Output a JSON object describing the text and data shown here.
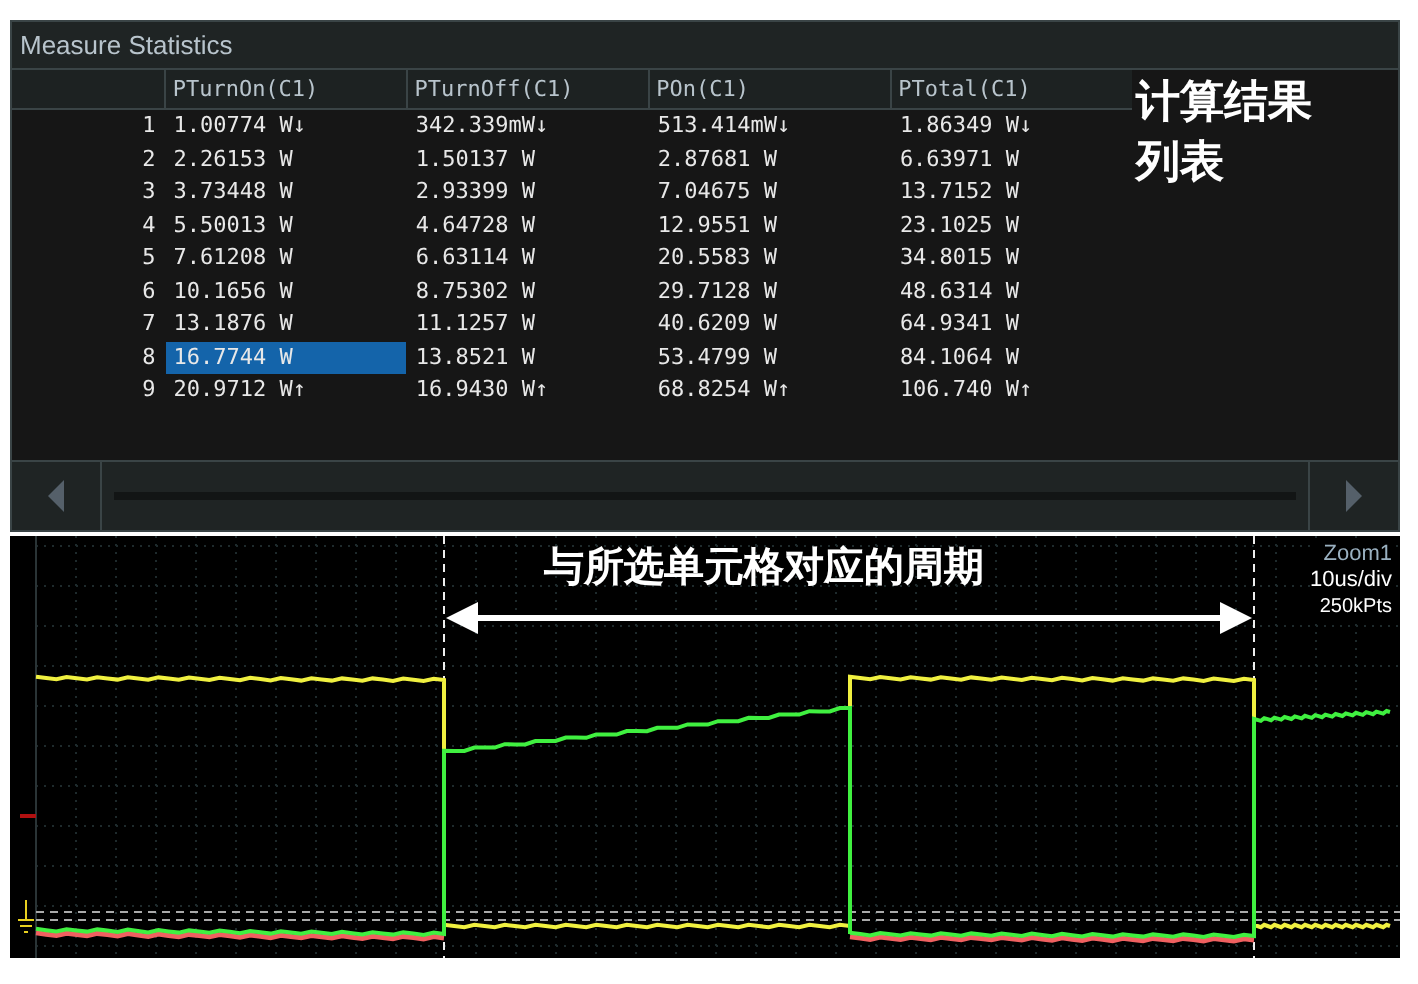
{
  "panel": {
    "title": "Measure Statistics"
  },
  "table": {
    "columns": [
      "PTurnOn(C1)",
      "PTurnOff(C1)",
      "POn(C1)",
      "PTotal(C1)"
    ],
    "rows": [
      {
        "index": "1",
        "cells": [
          {
            "text": "1.00774 W↓",
            "selected": false
          },
          {
            "text": "342.339mW↓",
            "selected": false
          },
          {
            "text": "513.414mW↓",
            "selected": false
          },
          {
            "text": "1.86349 W↓",
            "selected": false
          }
        ]
      },
      {
        "index": "2",
        "cells": [
          {
            "text": "2.26153 W",
            "selected": false
          },
          {
            "text": "1.50137 W",
            "selected": false
          },
          {
            "text": "2.87681 W",
            "selected": false
          },
          {
            "text": "6.63971 W",
            "selected": false
          }
        ]
      },
      {
        "index": "3",
        "cells": [
          {
            "text": "3.73448 W",
            "selected": false
          },
          {
            "text": "2.93399 W",
            "selected": false
          },
          {
            "text": "7.04675 W",
            "selected": false
          },
          {
            "text": "13.7152 W",
            "selected": false
          }
        ]
      },
      {
        "index": "4",
        "cells": [
          {
            "text": "5.50013 W",
            "selected": false
          },
          {
            "text": "4.64728 W",
            "selected": false
          },
          {
            "text": "12.9551 W",
            "selected": false
          },
          {
            "text": "23.1025 W",
            "selected": false
          }
        ]
      },
      {
        "index": "5",
        "cells": [
          {
            "text": "7.61208 W",
            "selected": false
          },
          {
            "text": "6.63114 W",
            "selected": false
          },
          {
            "text": "20.5583 W",
            "selected": false
          },
          {
            "text": "34.8015 W",
            "selected": false
          }
        ]
      },
      {
        "index": "6",
        "cells": [
          {
            "text": "10.1656 W",
            "selected": false
          },
          {
            "text": "8.75302 W",
            "selected": false
          },
          {
            "text": "29.7128 W",
            "selected": false
          },
          {
            "text": "48.6314 W",
            "selected": false
          }
        ]
      },
      {
        "index": "7",
        "cells": [
          {
            "text": "13.1876 W",
            "selected": false
          },
          {
            "text": "11.1257 W",
            "selected": false
          },
          {
            "text": "40.6209 W",
            "selected": false
          },
          {
            "text": "64.9341 W",
            "selected": false
          }
        ]
      },
      {
        "index": "8",
        "cells": [
          {
            "text": "16.7744 W",
            "selected": true
          },
          {
            "text": "13.8521 W",
            "selected": false
          },
          {
            "text": "53.4799 W",
            "selected": false
          },
          {
            "text": "84.1064 W",
            "selected": false
          }
        ]
      },
      {
        "index": "9",
        "cells": [
          {
            "text": "20.9712 W↑",
            "selected": false
          },
          {
            "text": "16.9430 W↑",
            "selected": false
          },
          {
            "text": "68.8254 W↑",
            "selected": false
          },
          {
            "text": "106.740 W↑",
            "selected": false
          }
        ]
      }
    ]
  },
  "table_note": "计算结果列表",
  "scope": {
    "period_note": "与所选单元格对应的周期",
    "zoom_label": "Zoom1",
    "timebase": "10us/div",
    "record_length": "250kPts"
  }
}
